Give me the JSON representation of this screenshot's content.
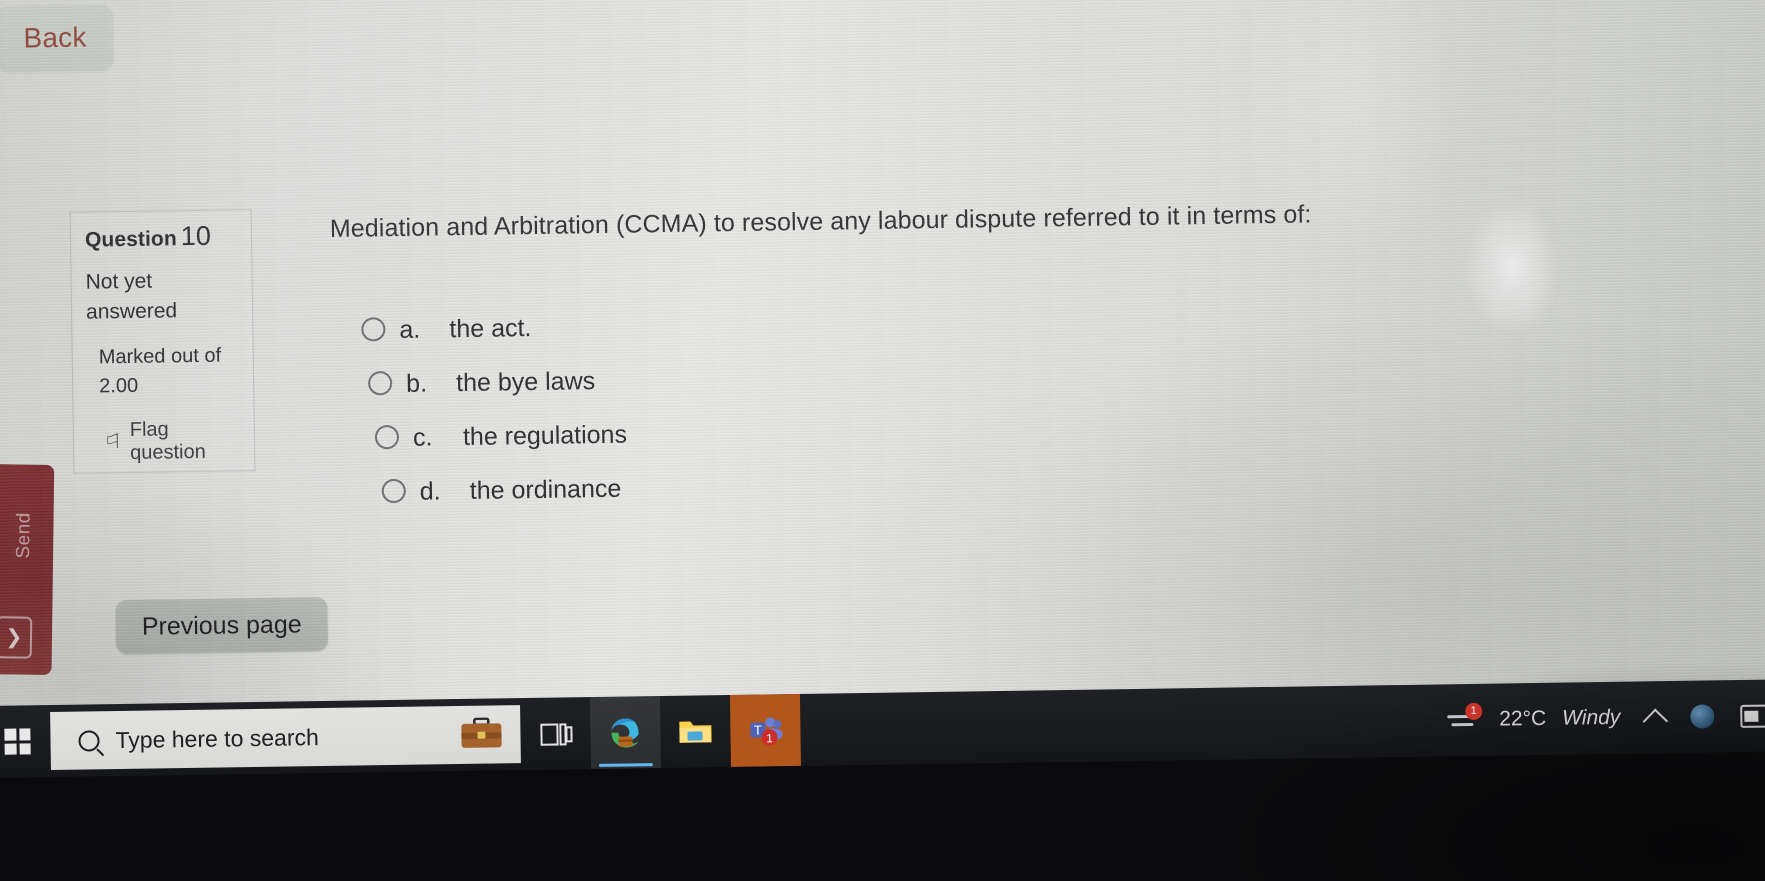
{
  "browser": {
    "back_label": "Back"
  },
  "side_rail": {
    "label": "Send",
    "toggle_icon": "chevron-right-icon"
  },
  "question": {
    "header_label": "Question",
    "number": "10",
    "state": "Not yet answered",
    "marked_label": "Marked out of",
    "marks": "2.00",
    "flag_label": "Flag question",
    "flag_icon": "flag-outline-icon",
    "stem": "Mediation and Arbitration (CCMA) to resolve any labour dispute referred to it in terms of:",
    "options": [
      {
        "letter": "a.",
        "text": "the act.",
        "selected": false
      },
      {
        "letter": "b.",
        "text": "the bye laws",
        "selected": false
      },
      {
        "letter": "c.",
        "text": "the regulations",
        "selected": false
      },
      {
        "letter": "d.",
        "text": "the ordinance",
        "selected": false
      }
    ]
  },
  "navigation": {
    "previous_page_label": "Previous page"
  },
  "taskbar": {
    "start_icon": "windows-logo-icon",
    "search_placeholder": "Type here to search",
    "search_icon": "search-icon",
    "search_briefcase_icon": "briefcase-icon",
    "items": [
      {
        "name": "task-view-icon",
        "label": "Task View",
        "active": false
      },
      {
        "name": "microsoft-edge-icon",
        "label": "Microsoft Edge",
        "active": true
      },
      {
        "name": "file-explorer-icon",
        "label": "File Explorer",
        "active": false
      },
      {
        "name": "microsoft-teams-icon",
        "label": "Microsoft Teams",
        "active": false,
        "badge": "1"
      }
    ],
    "tray": {
      "weather_icon": "windy-icon",
      "weather_badge": "1",
      "temperature": "22°C",
      "condition": "Windy",
      "show_hidden_icon": "chevron-up-icon",
      "network_icon": "network-globe-icon",
      "battery_icon": "battery-icon"
    }
  }
}
